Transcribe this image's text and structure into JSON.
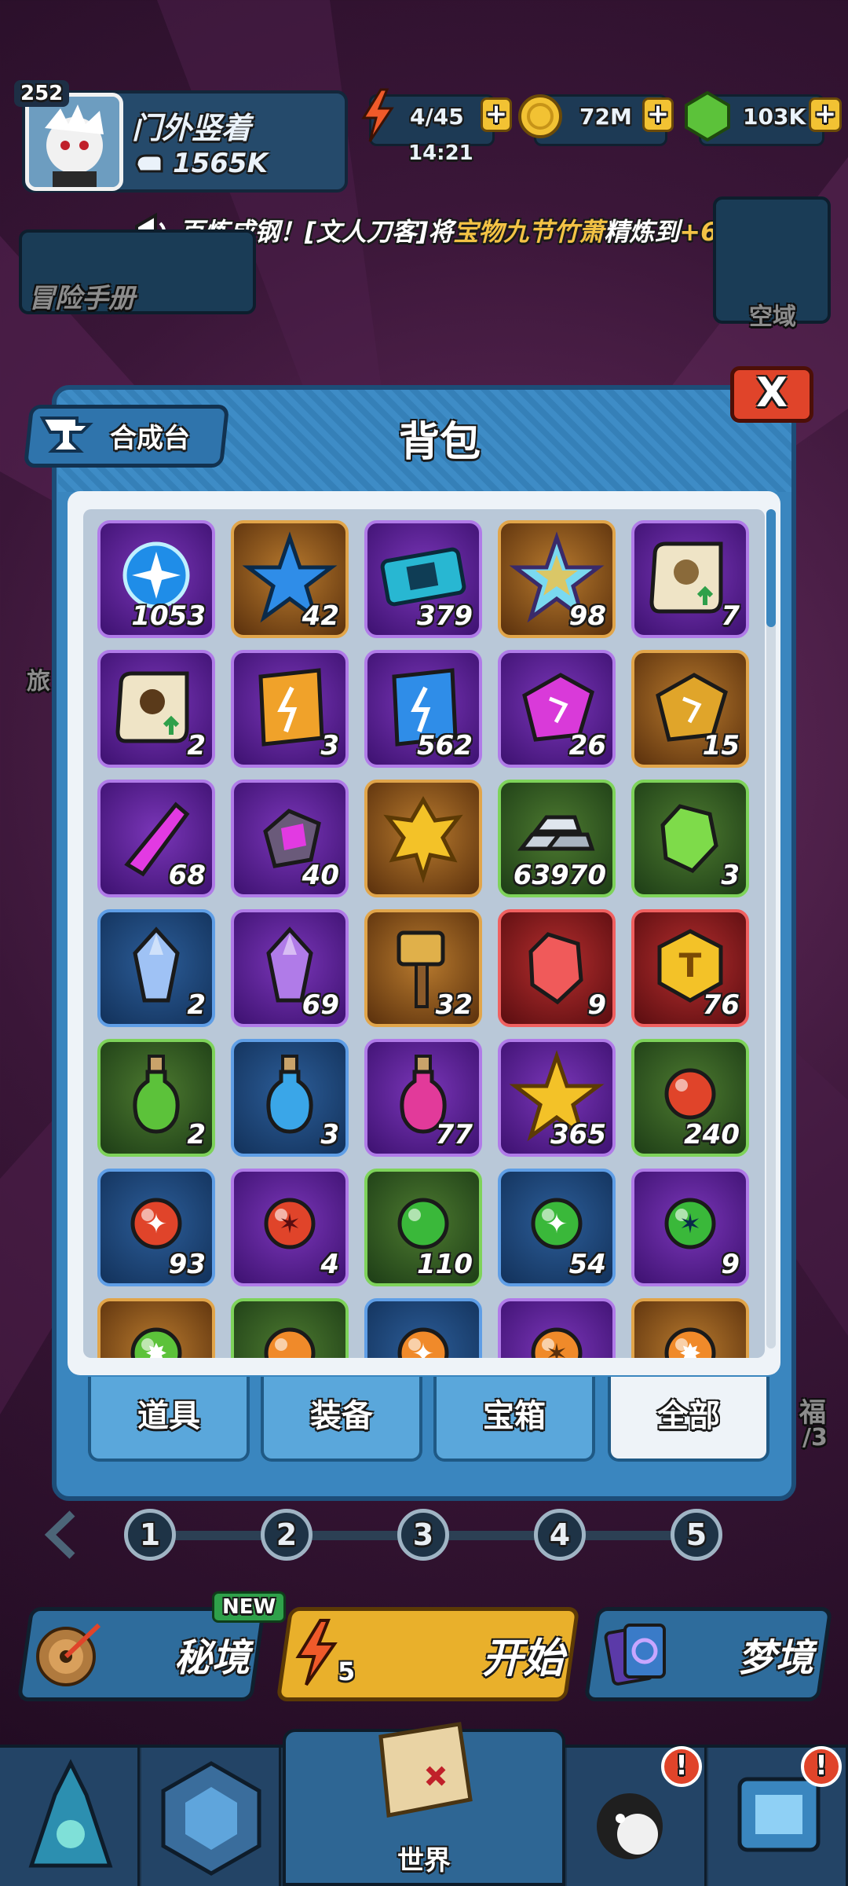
{
  "player": {
    "level": "252",
    "name": "门外竖着",
    "power": "1565K"
  },
  "resources": {
    "energy": "4/45",
    "timer": "14:21",
    "gold": "72M",
    "gems": "103K",
    "plus": "+"
  },
  "ticker": {
    "prefix": "百炼成钢！[文人刀客]将",
    "item": "宝物九节竹萧",
    "mid": "精炼到",
    "level": "+6",
    "suffix": "！"
  },
  "side": {
    "adventure": "冒险手册",
    "airspace": "空域",
    "left_partial": "旅",
    "right_partial_1": "福",
    "right_partial_2": "/3"
  },
  "panel": {
    "title": "背包",
    "craft_label": "合成台",
    "close": "X"
  },
  "inventory": [
    {
      "icon": "blue-orb-icon",
      "rarity": "purple",
      "count": "1053"
    },
    {
      "icon": "blue-star-icon",
      "rarity": "orange",
      "count": "42"
    },
    {
      "icon": "ticket-icon",
      "rarity": "purple",
      "count": "379"
    },
    {
      "icon": "rainbow-star-icon",
      "rarity": "orange",
      "count": "98"
    },
    {
      "icon": "scroll-icon",
      "rarity": "purple",
      "count": "7"
    },
    {
      "icon": "scroll-skull-icon",
      "rarity": "purple",
      "count": "2"
    },
    {
      "icon": "orange-packet-icon",
      "rarity": "purple",
      "count": "3"
    },
    {
      "icon": "blue-packet-icon",
      "rarity": "purple",
      "count": "562"
    },
    {
      "icon": "pink-rune-stone-icon",
      "rarity": "purple",
      "count": "26"
    },
    {
      "icon": "gold-rune-stone-icon",
      "rarity": "orange",
      "count": "15"
    },
    {
      "icon": "pink-crystal-icon",
      "rarity": "purple",
      "count": "68"
    },
    {
      "icon": "pink-ore-icon",
      "rarity": "purple",
      "count": "40"
    },
    {
      "icon": "gold-leaf-icon",
      "rarity": "orange",
      "count": ""
    },
    {
      "icon": "silver-ingots-icon",
      "rarity": "green",
      "count": "63970"
    },
    {
      "icon": "green-gem-icon",
      "rarity": "green",
      "count": "3"
    },
    {
      "icon": "blue-crystal-icon",
      "rarity": "blue",
      "count": "2"
    },
    {
      "icon": "purple-crystal-icon",
      "rarity": "purple",
      "count": "69"
    },
    {
      "icon": "hammer-icon",
      "rarity": "orange",
      "count": "32"
    },
    {
      "icon": "red-crystal-icon",
      "rarity": "red",
      "count": "9"
    },
    {
      "icon": "gold-hexagon-icon",
      "rarity": "red",
      "count": "76"
    },
    {
      "icon": "green-potion-icon",
      "rarity": "green",
      "count": "2"
    },
    {
      "icon": "blue-potion-icon",
      "rarity": "blue",
      "count": "3"
    },
    {
      "icon": "pink-potion-icon",
      "rarity": "purple",
      "count": "77"
    },
    {
      "icon": "gold-star-icon",
      "rarity": "purple",
      "count": "365"
    },
    {
      "icon": "red-ball-icon",
      "rarity": "green",
      "count": "240"
    },
    {
      "icon": "red-star-ball-icon",
      "rarity": "blue",
      "count": "93"
    },
    {
      "icon": "red-shuriken-ball-icon",
      "rarity": "purple",
      "count": "4"
    },
    {
      "icon": "green-ball-icon",
      "rarity": "green",
      "count": "110"
    },
    {
      "icon": "green-star-ball-icon",
      "rarity": "blue",
      "count": "54"
    },
    {
      "icon": "green-shuriken-ball-icon",
      "rarity": "purple",
      "count": "9"
    },
    {
      "icon": "green-burst-ball-icon",
      "rarity": "orange",
      "count": ""
    },
    {
      "icon": "orange-ball-icon",
      "rarity": "green",
      "count": ""
    },
    {
      "icon": "orange-star-ball-icon",
      "rarity": "blue",
      "count": ""
    },
    {
      "icon": "orange-shuriken-ball-icon",
      "rarity": "purple",
      "count": ""
    },
    {
      "icon": "orange-burst-ball-icon",
      "rarity": "orange",
      "count": ""
    }
  ],
  "tabs": [
    {
      "label": "道具",
      "active": false
    },
    {
      "label": "装备",
      "active": false
    },
    {
      "label": "宝箱",
      "active": false
    },
    {
      "label": "全部",
      "active": true
    }
  ],
  "stages": [
    "1",
    "2",
    "3",
    "4",
    "5"
  ],
  "modes": {
    "secret": "秘境",
    "new_badge": "NEW",
    "start": "开始",
    "start_cost": "5",
    "dream": "梦境"
  },
  "nav": {
    "world": "世界",
    "alert": "!"
  },
  "colors": {
    "purple": "#b07be8",
    "orange": "#e1a54a",
    "green": "#7ed35a",
    "blue": "#5f9ee6",
    "red": "#f06060",
    "panel": "#3a86bf",
    "close": "#e0442a"
  }
}
